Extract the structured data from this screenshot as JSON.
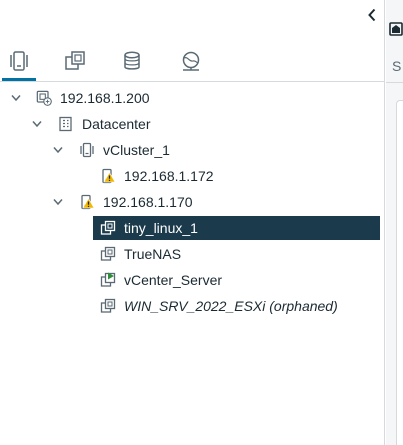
{
  "tree": {
    "host_root": {
      "label": "192.168.1.200",
      "icon": "vcenter-icon"
    },
    "datacenter": {
      "label": "Datacenter",
      "icon": "datacenter-icon"
    },
    "cluster": {
      "label": "vCluster_1",
      "icon": "cluster-icon"
    },
    "cluster_host": {
      "label": "192.168.1.172",
      "icon": "host-warning-icon"
    },
    "host": {
      "label": "192.168.1.170",
      "icon": "host-warning-icon"
    },
    "vms": [
      {
        "label": "tiny_linux_1",
        "icon": "vm-icon",
        "selected": true,
        "style": "normal"
      },
      {
        "label": "TrueNAS",
        "icon": "vm-icon",
        "selected": false,
        "style": "normal"
      },
      {
        "label": "vCenter_Server",
        "icon": "vm-running-icon",
        "selected": false,
        "style": "normal"
      },
      {
        "label": "WIN_SRV_2022_ESXi (orphaned)",
        "icon": "vm-icon",
        "selected": false,
        "style": "italic"
      }
    ]
  },
  "tabs": [
    {
      "name": "hosts-clusters-tab",
      "icon": "hosts-clusters-icon",
      "active": true
    },
    {
      "name": "vms-templates-tab",
      "icon": "vms-templates-icon",
      "active": false
    },
    {
      "name": "storage-tab",
      "icon": "storage-icon",
      "active": false
    },
    {
      "name": "networking-tab",
      "icon": "networking-icon",
      "active": false
    }
  ],
  "right_panel": {
    "partial_text": "S"
  },
  "colors": {
    "accent": "#0072a3",
    "selected_bg": "#1b3a4b",
    "warning": "#f2b700",
    "running": "#2e8f3a",
    "icon": "#5a6a74"
  }
}
